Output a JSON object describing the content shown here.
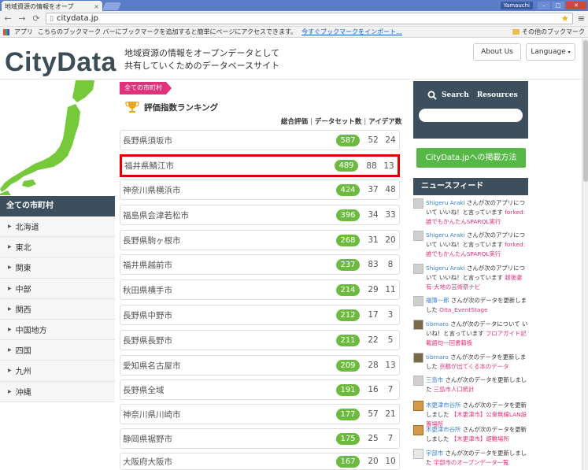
{
  "browser": {
    "tab_title": "地域資源の情報をオープ",
    "tab_close": "×",
    "user_badge": "Yamauchi",
    "url": "citydata.jp",
    "bookmarks_apps": "アプリ",
    "bookmarks_hint": "こちらのブックマーク バーにブックマークを追加すると簡単にページにアクセスできます。",
    "bookmarks_import": "今すぐブックマークをインポート...",
    "bookmarks_other": "その他のブックマーク"
  },
  "header": {
    "logo": "CityData",
    "tagline_line1": "地域資源の情報をオープンデータとして",
    "tagline_line2": "共有していくためのデータベースサイト",
    "about_label": "About Us",
    "language_label": "Language"
  },
  "sidebar": {
    "title": "全ての市町村",
    "items": [
      {
        "label": "北海道"
      },
      {
        "label": "東北"
      },
      {
        "label": "関東"
      },
      {
        "label": "中部"
      },
      {
        "label": "関西"
      },
      {
        "label": "中国地方"
      },
      {
        "label": "四国"
      },
      {
        "label": "九州"
      },
      {
        "label": "沖縄"
      }
    ]
  },
  "ranking": {
    "tab_label": "全ての市町村",
    "title": "評価指数ランキング",
    "sort_overall": "総合評価",
    "sort_datasets": "データセット数",
    "sort_ideas": "アイデア数",
    "sort_sep": "|",
    "rows": [
      {
        "name": "長野県須坂市",
        "score": "587",
        "datasets": "52",
        "ideas": "24"
      },
      {
        "name": "福井県鯖江市",
        "score": "489",
        "datasets": "88",
        "ideas": "13"
      },
      {
        "name": "神奈川県横浜市",
        "score": "424",
        "datasets": "37",
        "ideas": "48"
      },
      {
        "name": "福島県会津若松市",
        "score": "396",
        "datasets": "34",
        "ideas": "33"
      },
      {
        "name": "長野県駒ヶ根市",
        "score": "268",
        "datasets": "31",
        "ideas": "20"
      },
      {
        "name": "福井県越前市",
        "score": "237",
        "datasets": "83",
        "ideas": "8"
      },
      {
        "name": "秋田県横手市",
        "score": "214",
        "datasets": "29",
        "ideas": "11"
      },
      {
        "name": "長野県中野市",
        "score": "212",
        "datasets": "17",
        "ideas": "3"
      },
      {
        "name": "長野県長野市",
        "score": "211",
        "datasets": "22",
        "ideas": "5"
      },
      {
        "name": "愛知県名古屋市",
        "score": "209",
        "datasets": "28",
        "ideas": "13"
      },
      {
        "name": "長野県全域",
        "score": "191",
        "datasets": "16",
        "ideas": "7"
      },
      {
        "name": "神奈川県川崎市",
        "score": "177",
        "datasets": "57",
        "ideas": "21"
      },
      {
        "name": "静岡県裾野市",
        "score": "175",
        "datasets": "25",
        "ideas": "7"
      },
      {
        "name": "大阪府大阪市",
        "score": "167",
        "datasets": "20",
        "ideas": "10"
      }
    ]
  },
  "right": {
    "search_label": "Search",
    "resources_label": "Resources",
    "publish_button": "CityData.jpへの掲載方法",
    "news_title": "ニュースフィード",
    "news": [
      {
        "user": "Shigeru Araki",
        "text": " さんが次のアプリについて いいね！と言っています ",
        "link": "forked:誰でもかんたんSPARQL実行"
      },
      {
        "user": "Shigeru Araki",
        "text": " さんが次のアプリについて いいね！と言っています ",
        "link": "forked:誰でもかんたんSPARQL実行"
      },
      {
        "user": "Shigeru Araki",
        "text": " さんが次のアプリについて いいね！と言っています ",
        "link": "越後妻有-大地の芸術祭ナビ"
      },
      {
        "user": "福簿一郎",
        "text": " さんが次のデータを更新しました ",
        "link": "Oita_EventStage"
      },
      {
        "user": "tibmaro",
        "text": " さんが次のデータについて いいね！と言っています ",
        "link": "フロアガイド記載語句一回書籍板"
      },
      {
        "user": "tibmaro",
        "text": " さんが次のデータを更新しました ",
        "link": "京都が出てくる本のデータ"
      },
      {
        "user": "三島市",
        "text": " さんが次のデータを更新しました ",
        "link": "三島市人口統計"
      },
      {
        "user": "木更津市谷所",
        "text": " さんが次のデータを更新しました ",
        "link": "【木更津市】公衆無線LAN設置場所"
      },
      {
        "user": "木更津市谷所",
        "text": " さんが次のデータを更新しました ",
        "link": "【木更津市】避難場所"
      },
      {
        "user": "宇部市",
        "text": " さんが次のデータを更新しました ",
        "link": "宇部市のオープンデータ一覧"
      }
    ]
  },
  "colors": {
    "accent_pink": "#e2317a",
    "score_green": "#6dbb3e",
    "dark_slate": "#3d4f5c",
    "highlight_red": "#e00000"
  }
}
